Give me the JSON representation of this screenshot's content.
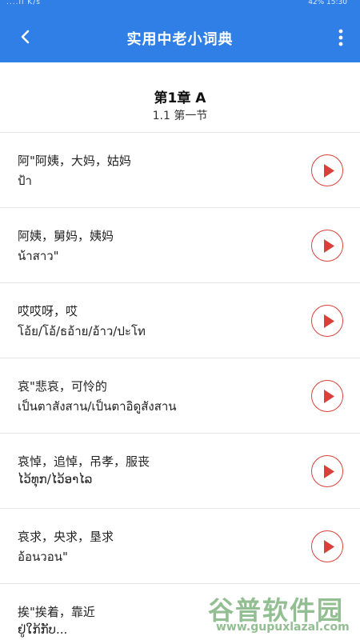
{
  "statusbar": {
    "left": "....ıl K/s",
    "right": "42%  15:30"
  },
  "header": {
    "title": "实用中老小词典",
    "back_icon": "chevron-left-icon",
    "more_icon": "more-vertical-icon",
    "accent_color": "#2f7fe6"
  },
  "chapter": {
    "title": "第1章  A",
    "subtitle": "1.1    第一节"
  },
  "entries": [
    {
      "zh": "阿\"阿姨，大妈，姑妈",
      "lo": "ป้า"
    },
    {
      "zh": "阿姨，舅妈，姨妈",
      "lo": "น้าสาว\""
    },
    {
      "zh": "哎哎呀，哎",
      "lo": "โอ้ย/โอ้/ธอ้าย/อ้าว/ปะโท"
    },
    {
      "zh": "哀\"悲哀，可怜的",
      "lo": "เป็นตาสังสาน/เป็นตาอิดูสังสาน"
    },
    {
      "zh": "哀悼，追悼，吊孝，服丧",
      "lo": "ໄວ້ທຸກ/ໄວ້ອາໄລ"
    },
    {
      "zh": "哀求，央求，垦求",
      "lo": "อ้อนวอน\""
    },
    {
      "zh": "挨\"挨着，靠近",
      "lo": "ຢູ່ໃກ້ກັບ..."
    }
  ],
  "play_icon": "play-icon",
  "play_color": "#d9403a",
  "watermark": {
    "text": "谷普软件园",
    "url": "www.gupuxlazal.com"
  }
}
